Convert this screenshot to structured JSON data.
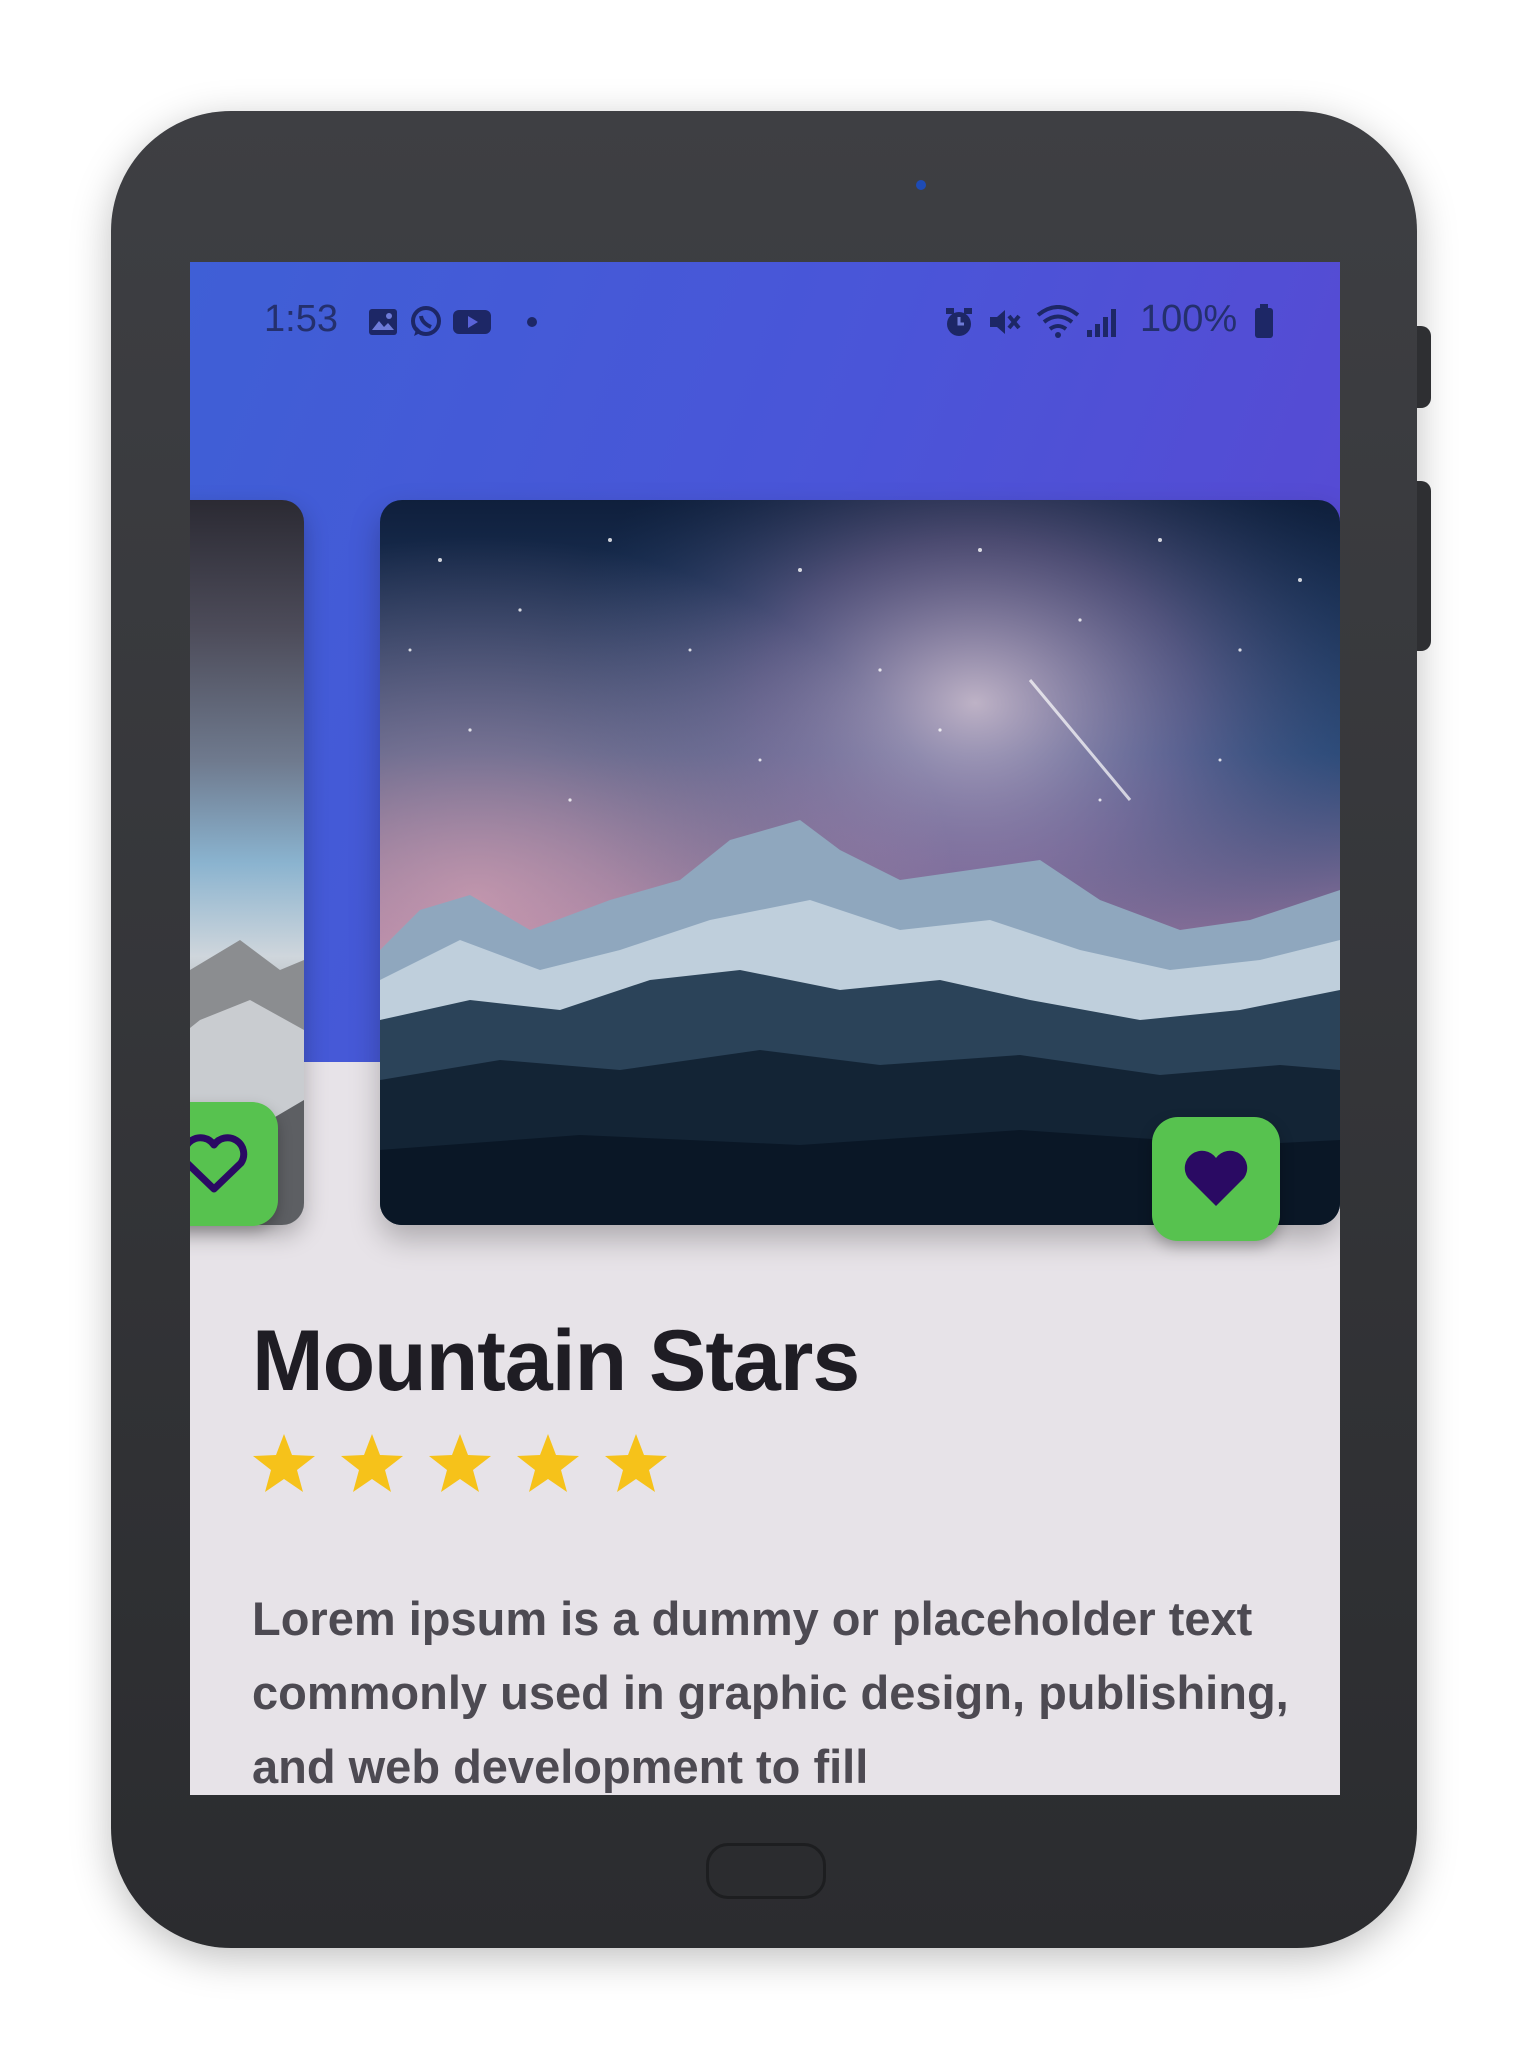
{
  "status_bar": {
    "time": "1:53",
    "left_icons": [
      "gallery-icon",
      "whatsapp-icon",
      "youtube-icon",
      "notification-dot-icon"
    ],
    "right_icons": [
      "alarm-icon",
      "mute-icon",
      "wifi-icon",
      "signal-icon",
      "battery-icon"
    ],
    "battery_level": "100%"
  },
  "carousel": {
    "current": {
      "title": "Mountain Stars",
      "rating": 5,
      "favorited": true
    }
  },
  "detail": {
    "title": "Mountain Stars",
    "rating_stars": 5,
    "description": "Lorem ipsum is a dummy or placeholder text commonly used in graphic design, publishing, and web development to fill"
  },
  "colors": {
    "header_gradient_start": "#3f5fd6",
    "header_gradient_end": "#5a47d2",
    "favorite_button": "#57c24f",
    "heart": "#2a0a63",
    "star": "#f6c21a",
    "content_background": "#e7e3e8"
  }
}
